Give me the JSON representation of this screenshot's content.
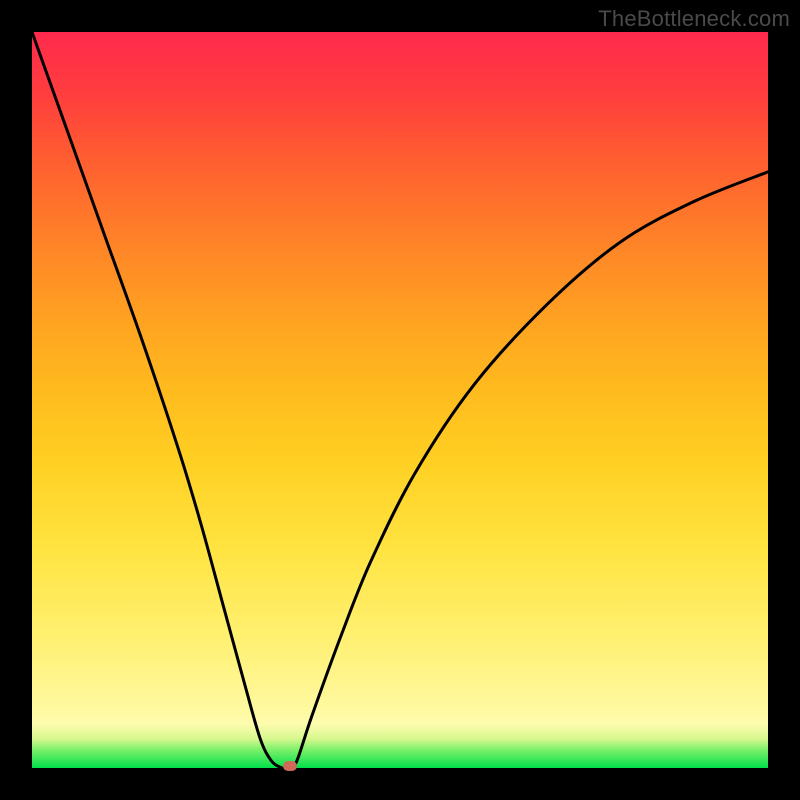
{
  "watermark": "TheBottleneck.com",
  "chart_data": {
    "type": "line",
    "title": "",
    "xlabel": "",
    "ylabel": "",
    "xlim": [
      0,
      100
    ],
    "ylim": [
      0,
      100
    ],
    "grid": false,
    "series": [
      {
        "name": "curve",
        "x": [
          0,
          5,
          10,
          15,
          20,
          23,
          26,
          29,
          31,
          32.5,
          34,
          35,
          36,
          38,
          42,
          46,
          52,
          60,
          70,
          80,
          90,
          100
        ],
        "y": [
          100,
          86,
          72,
          58,
          43,
          33,
          22,
          11,
          4,
          1,
          0,
          0,
          1,
          7,
          18,
          28,
          40,
          52,
          63,
          71.5,
          77,
          81
        ]
      }
    ],
    "marker": {
      "x": 35,
      "y": 0,
      "color": "#cf6a58"
    },
    "background_gradient": {
      "top": "#ff2a4d",
      "mid": "#ffe340",
      "bottom": "#00e04a"
    }
  },
  "plot": {
    "inner_left": 32,
    "inner_top": 32,
    "inner_width": 736,
    "inner_height": 736
  }
}
